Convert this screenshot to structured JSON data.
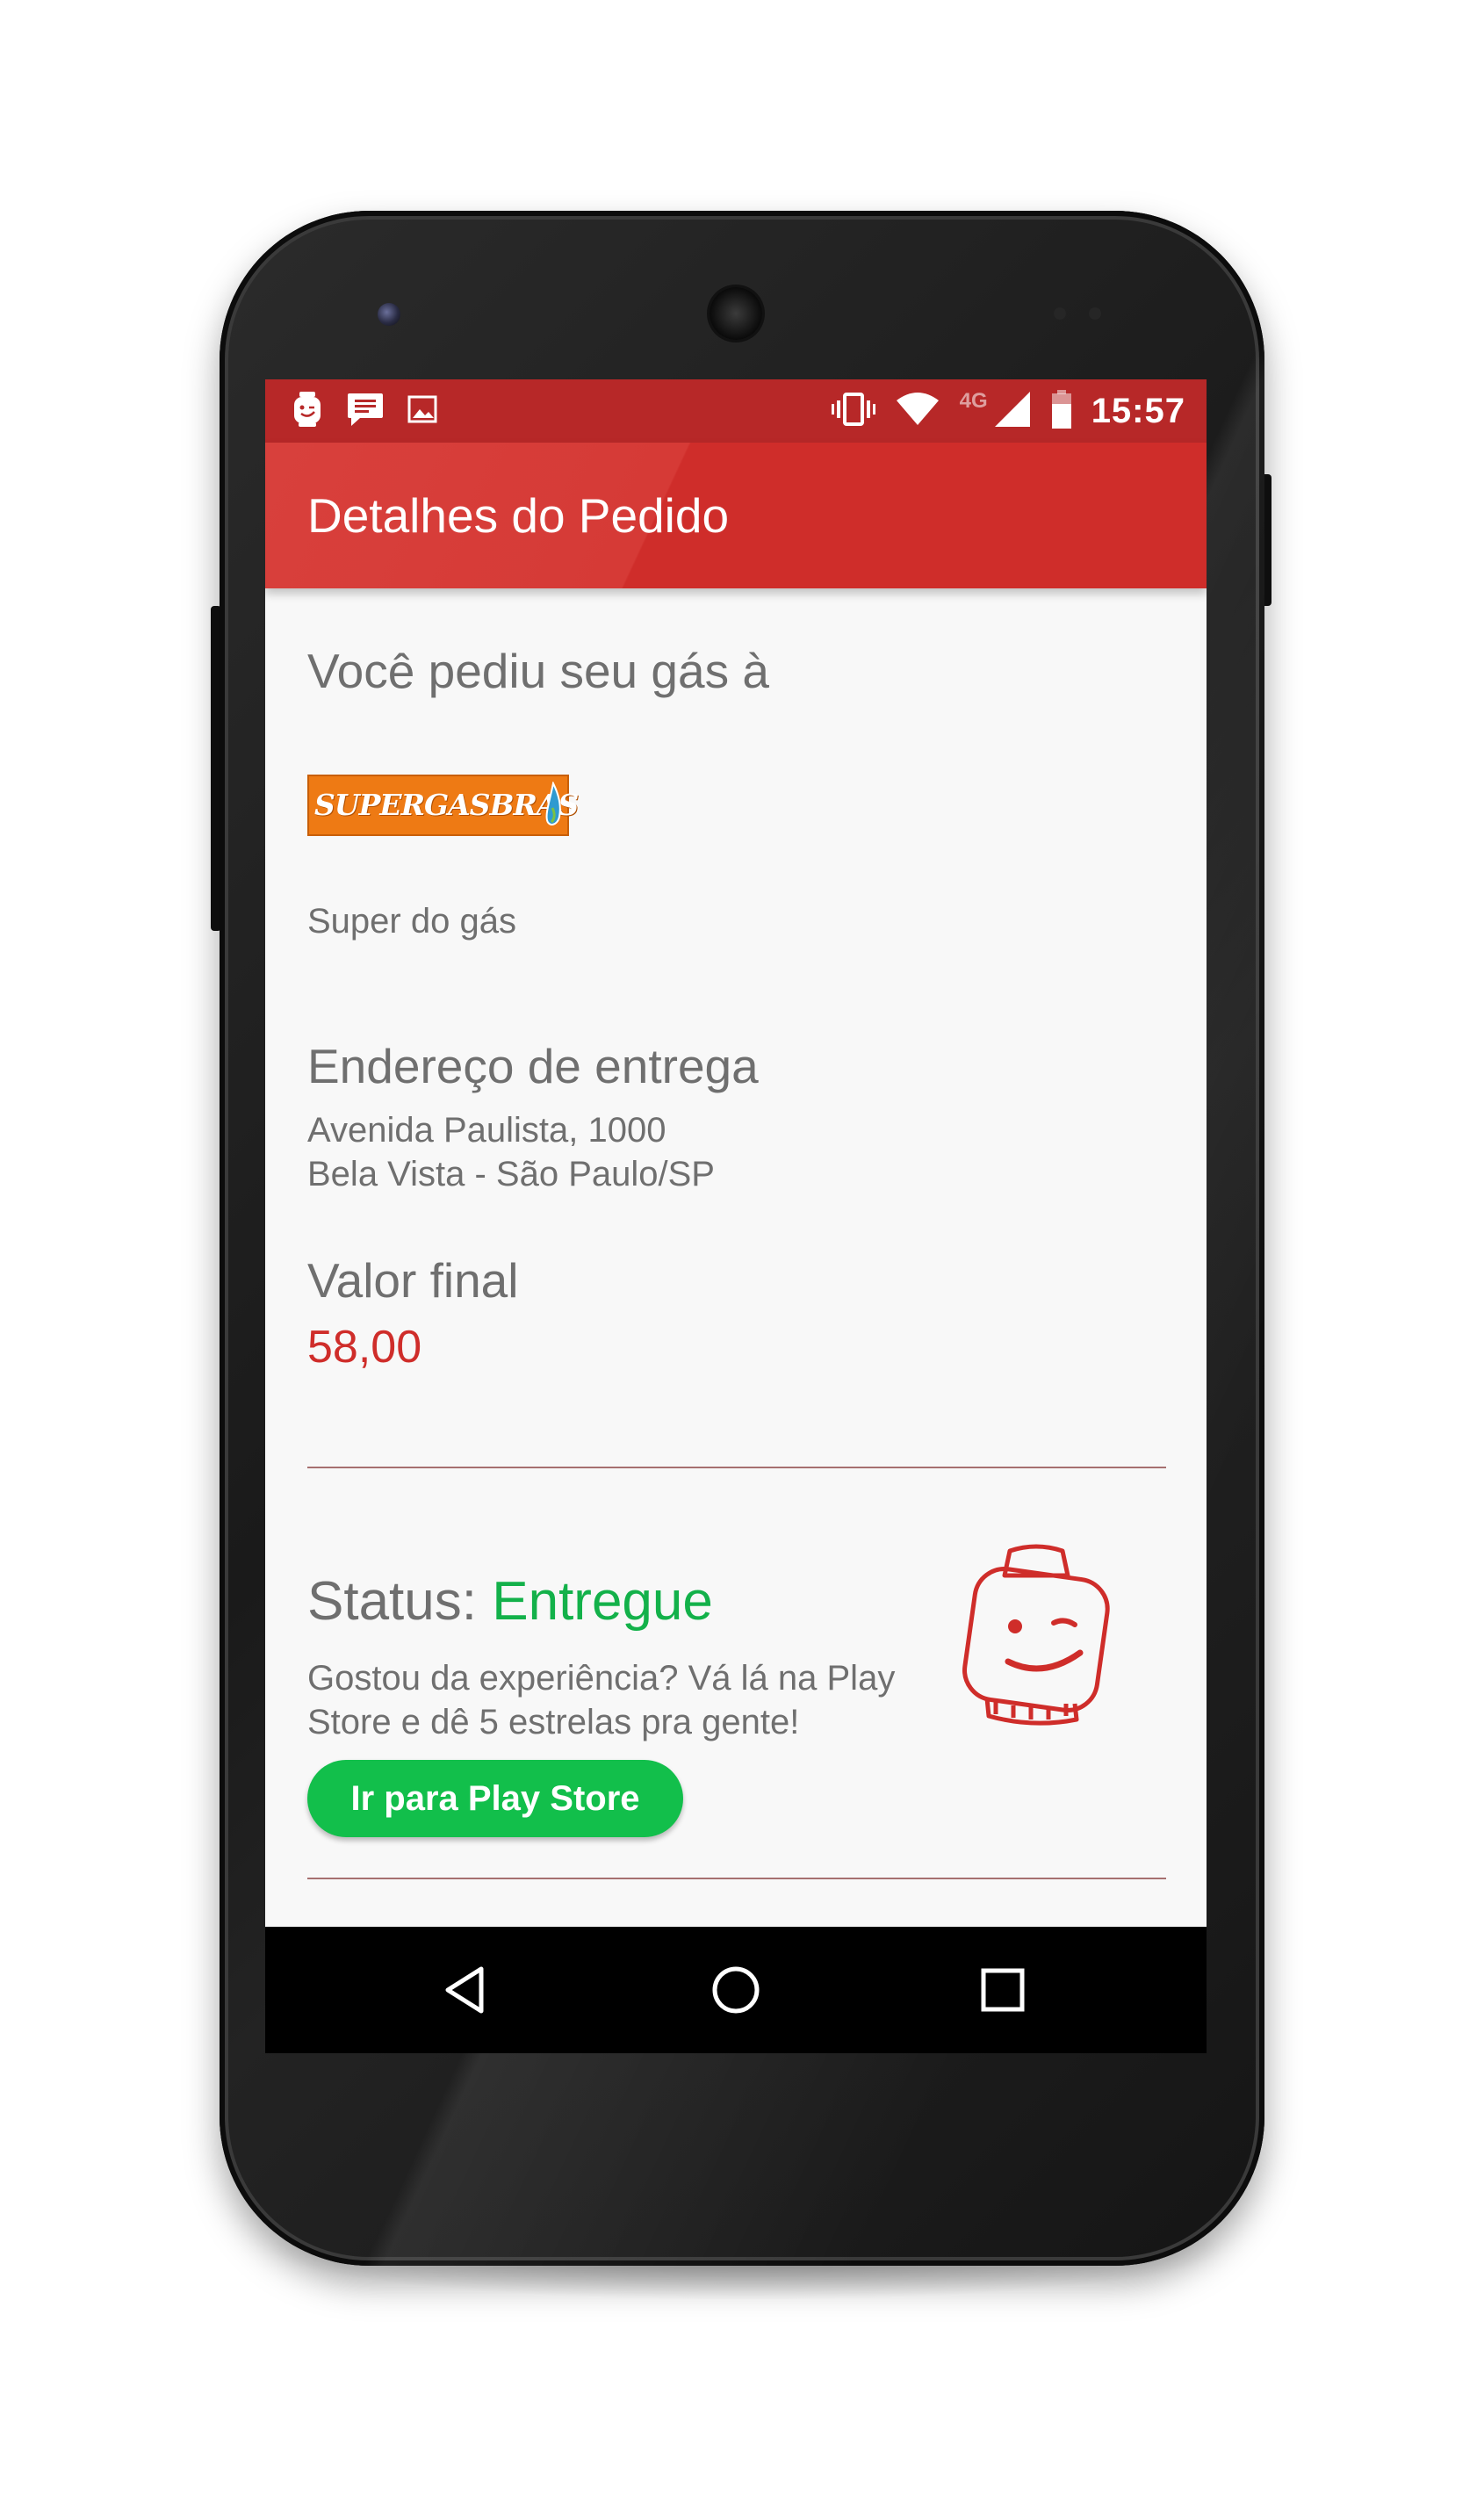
{
  "status_bar": {
    "time": "15:57",
    "network": "4G",
    "left_icons": [
      "mascot-notification-icon",
      "message-icon",
      "image-icon"
    ],
    "right_icons": [
      "vibrate-icon",
      "wifi-icon",
      "signal-icon",
      "battery-icon"
    ]
  },
  "app_bar": {
    "title": "Detalhes do Pedido"
  },
  "order": {
    "intro": "Você pediu seu gás à",
    "supplier_logo_text": "SUPERGASBRAS",
    "supplier_name": "Super do gás",
    "address_heading": "Endereço de entrega",
    "address_line1": "Avenida Paulista, 1000",
    "address_line2": "Bela Vista - São Paulo/SP",
    "value_heading": "Valor final",
    "value": "58,00"
  },
  "status": {
    "label": "Status:",
    "value": "Entregue",
    "message_line1": "Gostou da experiência? Vá lá na Play",
    "message_line2": "Store e dê 5 estrelas pra gente!",
    "button_label": "Ir para Play Store"
  },
  "navigation": {
    "buttons": [
      "back-icon",
      "home-icon",
      "recents-icon"
    ]
  },
  "colors": {
    "app_bar": "#cf2d2a",
    "status_bar": "#b72828",
    "price": "#cf2d2a",
    "status_value": "#13b14a",
    "cta_button": "#12bf4b",
    "logo_bg": "#ee7a14"
  }
}
